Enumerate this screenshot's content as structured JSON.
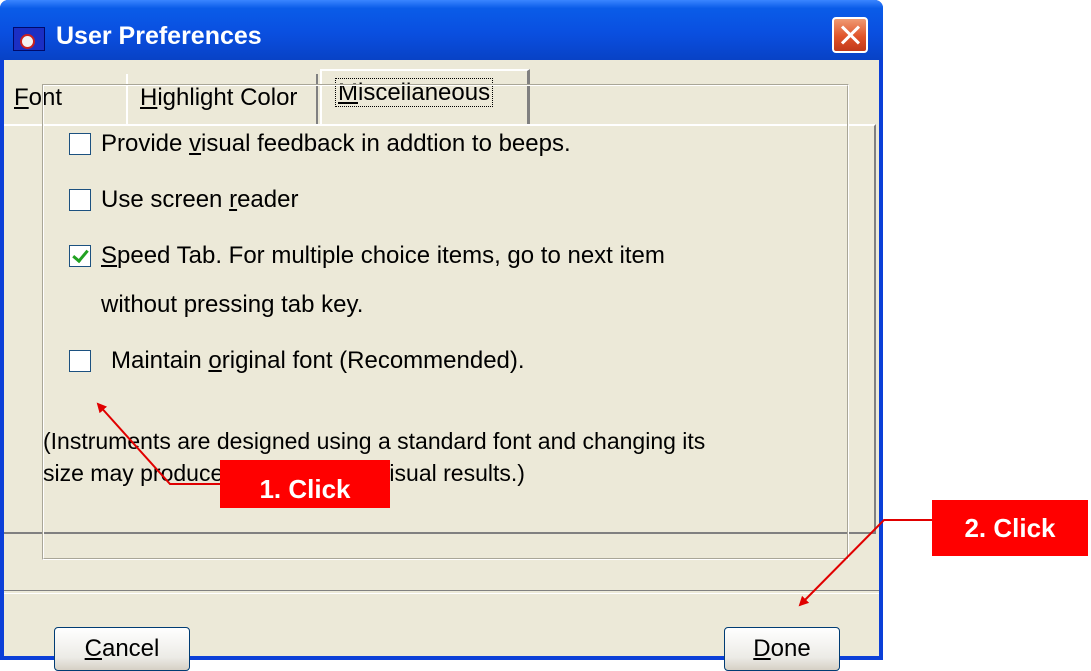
{
  "window": {
    "title": "User Preferences"
  },
  "tabs": [
    {
      "label": "Font",
      "accel": "F",
      "rest": "ont"
    },
    {
      "label": "Highlight Color",
      "accel": "H",
      "rest": "ighlight Color"
    },
    {
      "label": "Miscellaneous",
      "accel": "M",
      "rest": "iscellaneous",
      "selected": true
    }
  ],
  "options": [
    {
      "before": "Provide ",
      "accel": "v",
      "after": "isual feedback in addtion to beeps.",
      "checked": false
    },
    {
      "before": "Use screen ",
      "accel": "r",
      "after": "eader",
      "checked": false
    },
    {
      "before": "",
      "accel": "S",
      "after": "peed Tab. For multiple choice items, go to next item",
      "after2": "without pressing tab key.",
      "checked": true
    },
    {
      "before": "Maintain ",
      "accel": "o",
      "after": "riginal font (Recommended).",
      "checked": false
    }
  ],
  "note": {
    "line1": "(Instruments are designed using a standard font and changing its",
    "line2": "size may produce unsatisfactory visual results.)"
  },
  "buttons": {
    "cancel": {
      "accel": "C",
      "rest": "ancel"
    },
    "done": {
      "accel": "D",
      "rest": "one"
    }
  },
  "annotations": {
    "step1": "1. Click",
    "step2": "2. Click",
    "color": "#ff0000"
  }
}
